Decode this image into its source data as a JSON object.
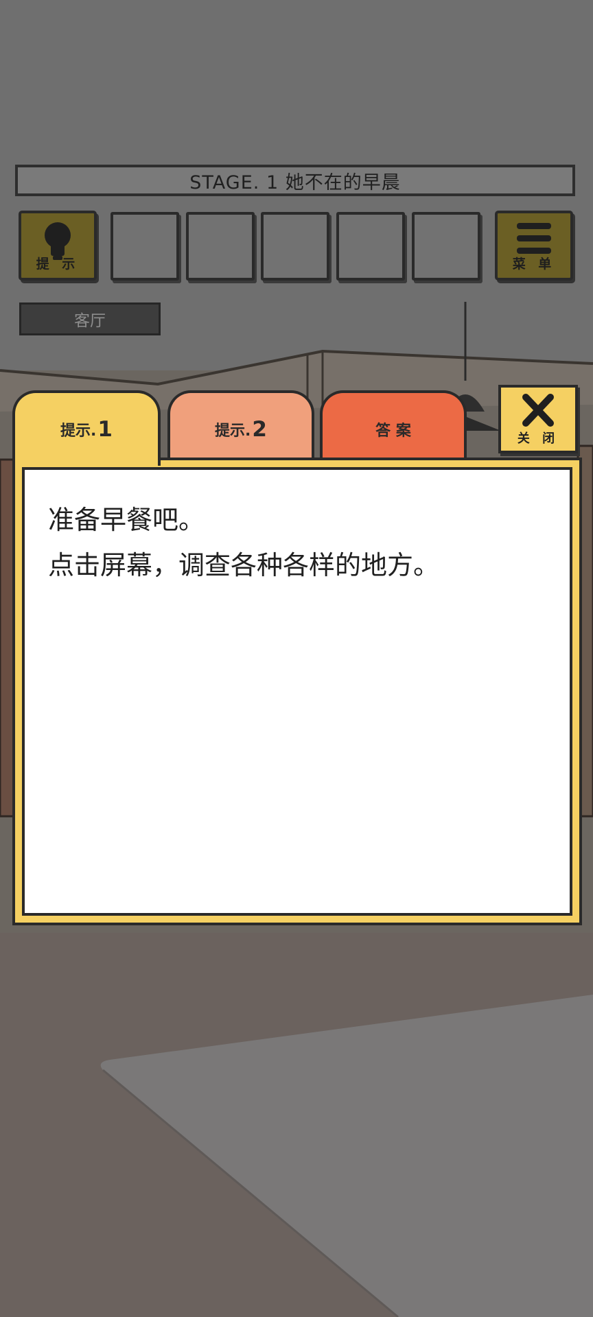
{
  "stage_title": "STAGE. 1 她不在的早晨",
  "toolbar": {
    "hint_label": "提 示",
    "menu_label": "菜 单",
    "hint_icon": "lightbulb-icon",
    "menu_icon": "hamburger-icon"
  },
  "room_name": "客厅",
  "dialog": {
    "tabs": [
      {
        "label": "提示.",
        "num": "1"
      },
      {
        "label": "提示.",
        "num": "2"
      },
      {
        "label": "答 案"
      }
    ],
    "close_label": "关 闭",
    "close_icon": "close-x-icon",
    "hint_lines": [
      "准备早餐吧。",
      "点击屏幕，调查各种各样的地方。"
    ]
  },
  "colors": {
    "tab_hint1": "#f5d062",
    "tab_hint2": "#f0a07c",
    "tab_answer": "#ec6a45"
  }
}
